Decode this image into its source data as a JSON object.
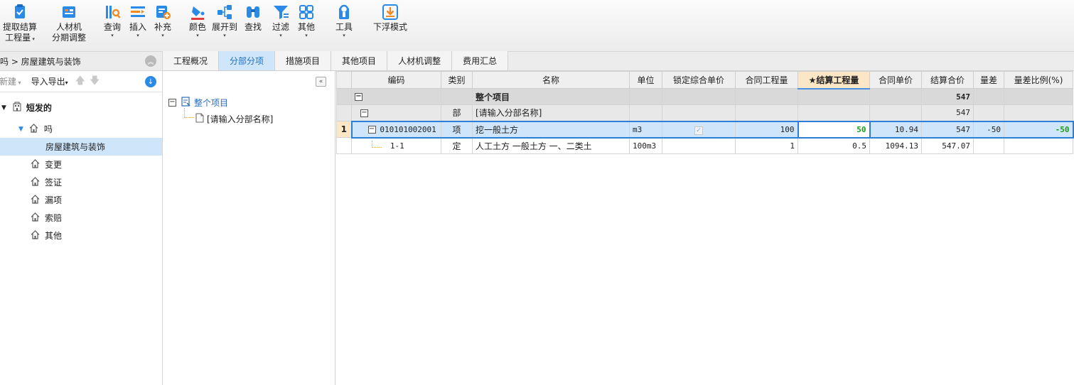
{
  "toolbar": {
    "items": [
      {
        "label1": "提取结算",
        "label2": "工程量",
        "icon": "extract-icon"
      },
      {
        "label1": "人材机",
        "label2": "分期调整",
        "icon": "material-icon"
      },
      {
        "label1": "查询",
        "icon": "query-icon"
      },
      {
        "label1": "插入",
        "icon": "insert-icon"
      },
      {
        "label1": "补充",
        "icon": "supplement-icon"
      },
      {
        "label1": "颜色",
        "icon": "color-icon"
      },
      {
        "label1": "展开到",
        "icon": "expand-icon"
      },
      {
        "label1": "查找",
        "icon": "find-icon"
      },
      {
        "label1": "过滤",
        "icon": "filter-icon"
      },
      {
        "label1": "其他",
        "icon": "other-icon"
      },
      {
        "label1": "工具",
        "icon": "tools-icon"
      },
      {
        "label1": "下浮模式",
        "icon": "float-down-icon"
      }
    ]
  },
  "left": {
    "breadcrumb": "吗 > 房屋建筑与装饰",
    "new_label": "新建",
    "import_export_label": "导入导出",
    "tree": [
      {
        "label": "短发的",
        "icon": "building-icon"
      },
      {
        "label": "吗",
        "icon": "home-icon"
      },
      {
        "label": "房屋建筑与装饰"
      },
      {
        "label": "变更",
        "icon": "home-icon"
      },
      {
        "label": "签证",
        "icon": "home-icon"
      },
      {
        "label": "漏项",
        "icon": "home-icon"
      },
      {
        "label": "索赔",
        "icon": "home-icon"
      },
      {
        "label": "其他",
        "icon": "home-icon"
      }
    ]
  },
  "tabs": [
    "工程概况",
    "分部分项",
    "措施项目",
    "其他项目",
    "人材机调整",
    "费用汇总"
  ],
  "mid_tree": {
    "root": "整个项目",
    "child": "[请输入分部名称]"
  },
  "grid": {
    "headers": [
      "编码",
      "类别",
      "名称",
      "单位",
      "锁定综合单价",
      "合同工程量",
      "★结算工程量",
      "合同单价",
      "结算合价",
      "量差",
      "量差比例(%)"
    ],
    "rows": [
      {
        "name": "整个项目",
        "total": "547"
      },
      {
        "type": "部",
        "name": "[请输入分部名称]",
        "total": "547"
      },
      {
        "index": "1",
        "code": "010101002001",
        "type": "项",
        "name": "挖一般土方",
        "unit": "m3",
        "contract_qty": "100",
        "settle_qty": "50",
        "contract_price": "10.94",
        "total": "547",
        "diff": "-50",
        "diff_ratio": "-50"
      },
      {
        "code": "1-1",
        "type": "定",
        "name": "人工土方 一般土方 一、二类土",
        "unit": "100m3",
        "contract_qty": "1",
        "settle_qty": "0.5",
        "contract_price": "1094.13",
        "total": "547.07"
      }
    ]
  }
}
